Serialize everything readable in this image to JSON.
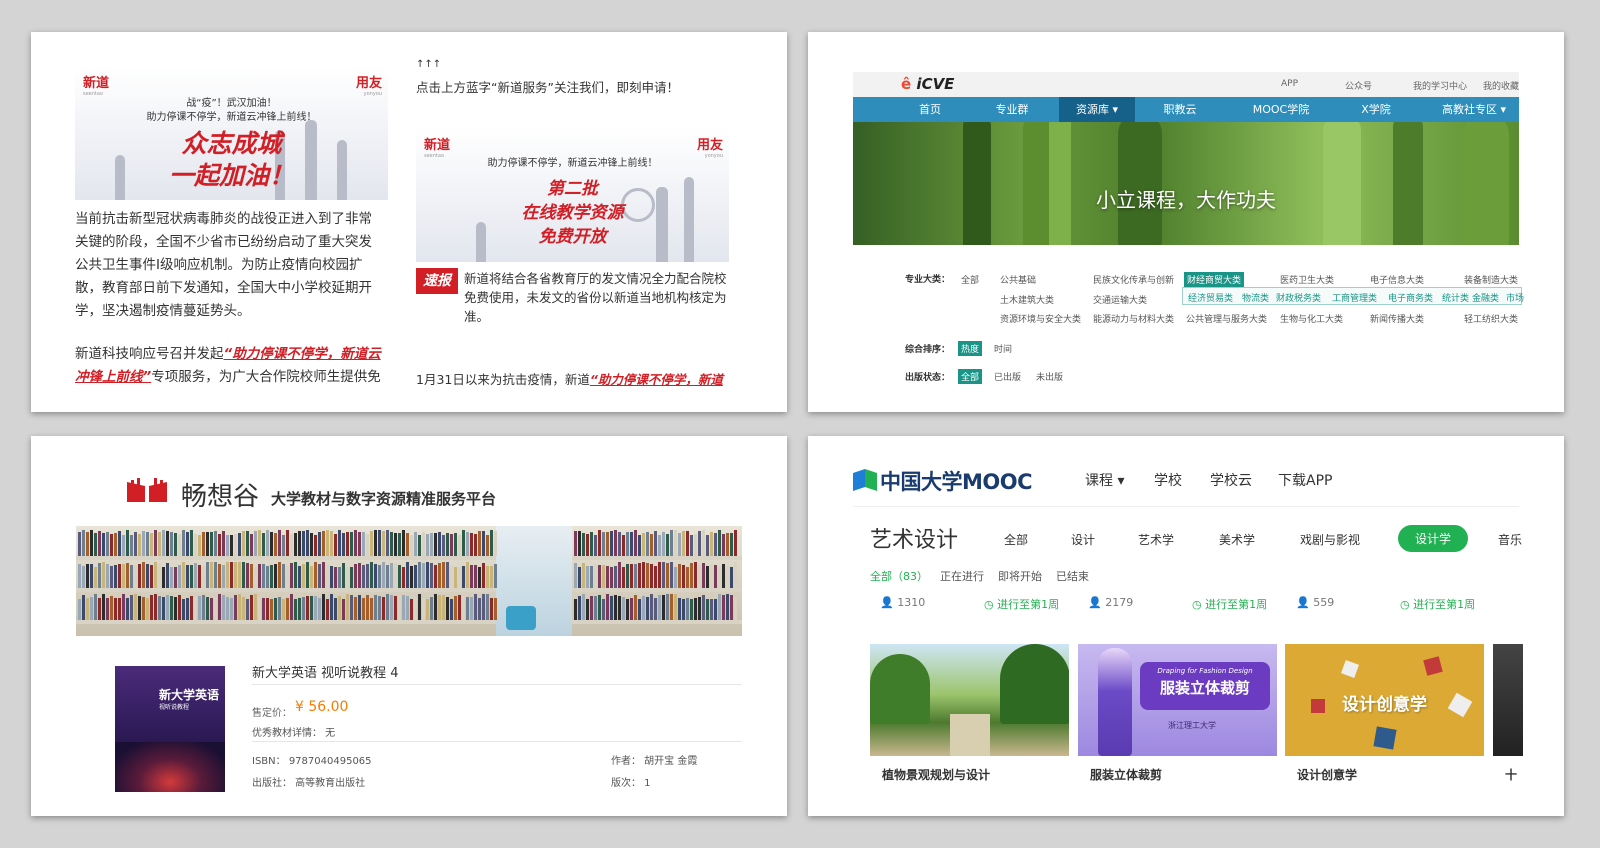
{
  "panel1": {
    "poster1": {
      "logo_left": "新道",
      "logo_left_sub": "seentao",
      "logo_right": "用友",
      "logo_right_sub": "yonyou",
      "line1": "战“疫”！武汉加油！",
      "line2": "助力停课不停学，新道云冲锋上前线！",
      "big1": "众志成城",
      "big2": "一起加油！"
    },
    "paragraph1_lines": [
      "当前抗击新型冠状病毒肺炎的战役正进入到了非常",
      "关键的阶段，全国不少省市已纷纷启动了重大突发",
      "公共卫生事件Ⅰ级响应机制。为防止疫情向校园扩",
      "散，教育部日前下发通知，全国大中小学校延期开",
      "学，坚决遏制疫情蔓延势头。"
    ],
    "paragraph2_prefix": "新道科技响应号召并发起",
    "paragraph2_link_a": "“助力停课不停学，新道云",
    "paragraph2_link_b": "冲锋上前线”",
    "paragraph2_suffix": "专项服务，为广大合作院校师生提供免",
    "arrows": "↑↑↑",
    "follow_text": "点击上方蓝字“新道服务”关注我们，即刻申请！",
    "poster2": {
      "logo_left": "新道",
      "logo_left_sub": "seentao",
      "logo_right": "用友",
      "logo_right_sub": "yonyou",
      "line1": "助力停课不停学，新道云冲锋上前线！",
      "big1": "第二批",
      "big2": "在线教学资源",
      "big3": "免费开放"
    },
    "news_tag": "速报",
    "news_lines": [
      "新道将结合各省教育厅的发文情况全力配合院校",
      "免费使用，未发文的省份以新道当地机构核定为",
      "准。"
    ],
    "bottom_prefix": "1月31日以来为抗击疫情，新道",
    "bottom_link": "“助力停课不停学，新道"
  },
  "panel2": {
    "logo_mark": "ê",
    "logo_text": "iCVE",
    "top_links": [
      "APP",
      "公众号",
      "我的学习中心",
      "我的收藏"
    ],
    "nav": [
      "首页",
      "专业群",
      "资源库 ▾",
      "职教云",
      "MOOC学院",
      "X学院",
      "高教社专区 ▾"
    ],
    "banner_text": "小立课程，大作功夫",
    "filter_major_label": "专业大类：",
    "major_row1": [
      "全部",
      "公共基础",
      "民族文化传承与创新",
      "财经商贸大类",
      "医药卫生大类",
      "电子信息大类",
      "装备制造大类"
    ],
    "major_row2": [
      "土木建筑大类",
      "交通运输大类"
    ],
    "major_sub": [
      "经济贸易类",
      "物流类",
      "财政税务类",
      "工商管理类",
      "电子商务类",
      "统计类",
      "金融类",
      "市场"
    ],
    "major_row3": [
      "资源环境与安全大类",
      "能源动力与材料大类",
      "公共管理与服务大类",
      "生物与化工大类",
      "新闻传播大类",
      "轻工纺织大类"
    ],
    "sort_label": "综合排序：",
    "sort_options": [
      "热度",
      "时间"
    ],
    "status_label": "出版状态：",
    "status_options": [
      "全部",
      "已出版",
      "未出版"
    ]
  },
  "panel3": {
    "brand": "畅想谷",
    "subtitle": "大学教材与数字资源精准服务平台",
    "cover_title": "新大学英语",
    "cover_sub": "视听说教程",
    "book_title": "新大学英语 视听说教程 4",
    "price_label": "售定价：",
    "price": "¥ 56.00",
    "excellent_label": "优秀教材详情： 无",
    "isbn": "ISBN： 9787040495065",
    "publisher": "出版社： 高等教育出版社",
    "author": "作者： 胡开宝 金霞",
    "edition": "版次： 1"
  },
  "panel4": {
    "logo_text": "中国大学MOOC",
    "nav": [
      "课程 ▾",
      "学校",
      "学校云",
      "下载APP"
    ],
    "category": "艺术设计",
    "subcats": [
      "全部",
      "设计",
      "艺术学",
      "美术学",
      "戏剧与影视",
      "设计学",
      "音乐"
    ],
    "states": [
      "全部（83）",
      "正在进行",
      "即将开始",
      "已结束"
    ],
    "cards": [
      {
        "learners": "1310",
        "progress": "进行至第1周",
        "title": "植物景观规划与设计"
      },
      {
        "learners": "2179",
        "progress": "进行至第1周",
        "title": "服装立体裁剪",
        "badge_en": "Draping for Fashion Design",
        "badge_cn": "服装立体裁剪",
        "school": "浙江理工大学"
      },
      {
        "learners": "559",
        "progress": "进行至第1周",
        "title": "设计创意学",
        "badge_cn": "设计创意学"
      }
    ],
    "partial_title": "十"
  },
  "colors": {
    "red": "#d21f26",
    "icve_blue": "#2e8dbb",
    "teal": "#1a9487",
    "mooc_green": "#21b052",
    "price_orange": "#f57c00"
  }
}
